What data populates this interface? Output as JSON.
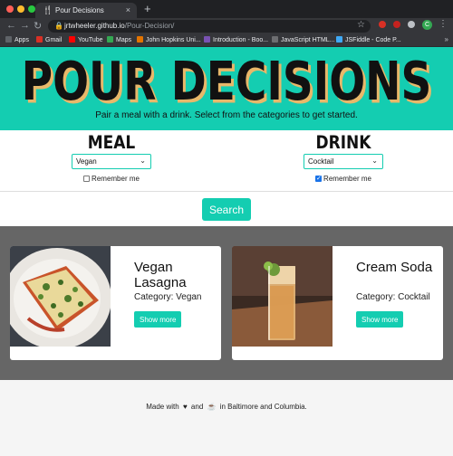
{
  "browser": {
    "tab_title": "Pour Decisions",
    "tab_icon": "utensils-icon",
    "url_host": "jrtwheeler.github.io",
    "url_path": "/Pour-Decision/",
    "profile_initial": "C",
    "bookmarks": [
      {
        "label": "Apps",
        "color": "#5f6368"
      },
      {
        "label": "Gmail",
        "color": "#d93025"
      },
      {
        "label": "YouTube",
        "color": "#ff0000"
      },
      {
        "label": "Maps",
        "color": "#34a853"
      },
      {
        "label": "John Hopkins Uni...",
        "color": "#e37400"
      },
      {
        "label": "Introduction - Boo...",
        "color": "#7952b3"
      },
      {
        "label": "JavaScript HTML...",
        "color": "#6d6e71"
      },
      {
        "label": "JSFiddle - Code P...",
        "color": "#3fa9f5"
      }
    ]
  },
  "hero": {
    "title": "POUR DECISIONS",
    "subtitle": "Pair a meal with a drink. Select from the categories to get started."
  },
  "meal": {
    "title": "MEAL",
    "selected": "Vegan",
    "remember_label": "Remember me",
    "remember_checked": false
  },
  "drink": {
    "title": "DRINK",
    "selected": "Cocktail",
    "remember_label": "Remember me",
    "remember_checked": true
  },
  "search_label": "Search",
  "results": [
    {
      "name": "Vegan Lasagna",
      "category": "Category: Vegan",
      "button": "Show more"
    },
    {
      "name": "Cream Soda",
      "category": "Category: Cocktail",
      "button": "Show more"
    }
  ],
  "footer": {
    "part1": "Made with",
    "part2": "and",
    "part3": "in Baltimore and Columbia."
  },
  "colors": {
    "accent": "#14cdb1",
    "title_shadow": "#e8b86a",
    "results_bg": "#666666"
  }
}
